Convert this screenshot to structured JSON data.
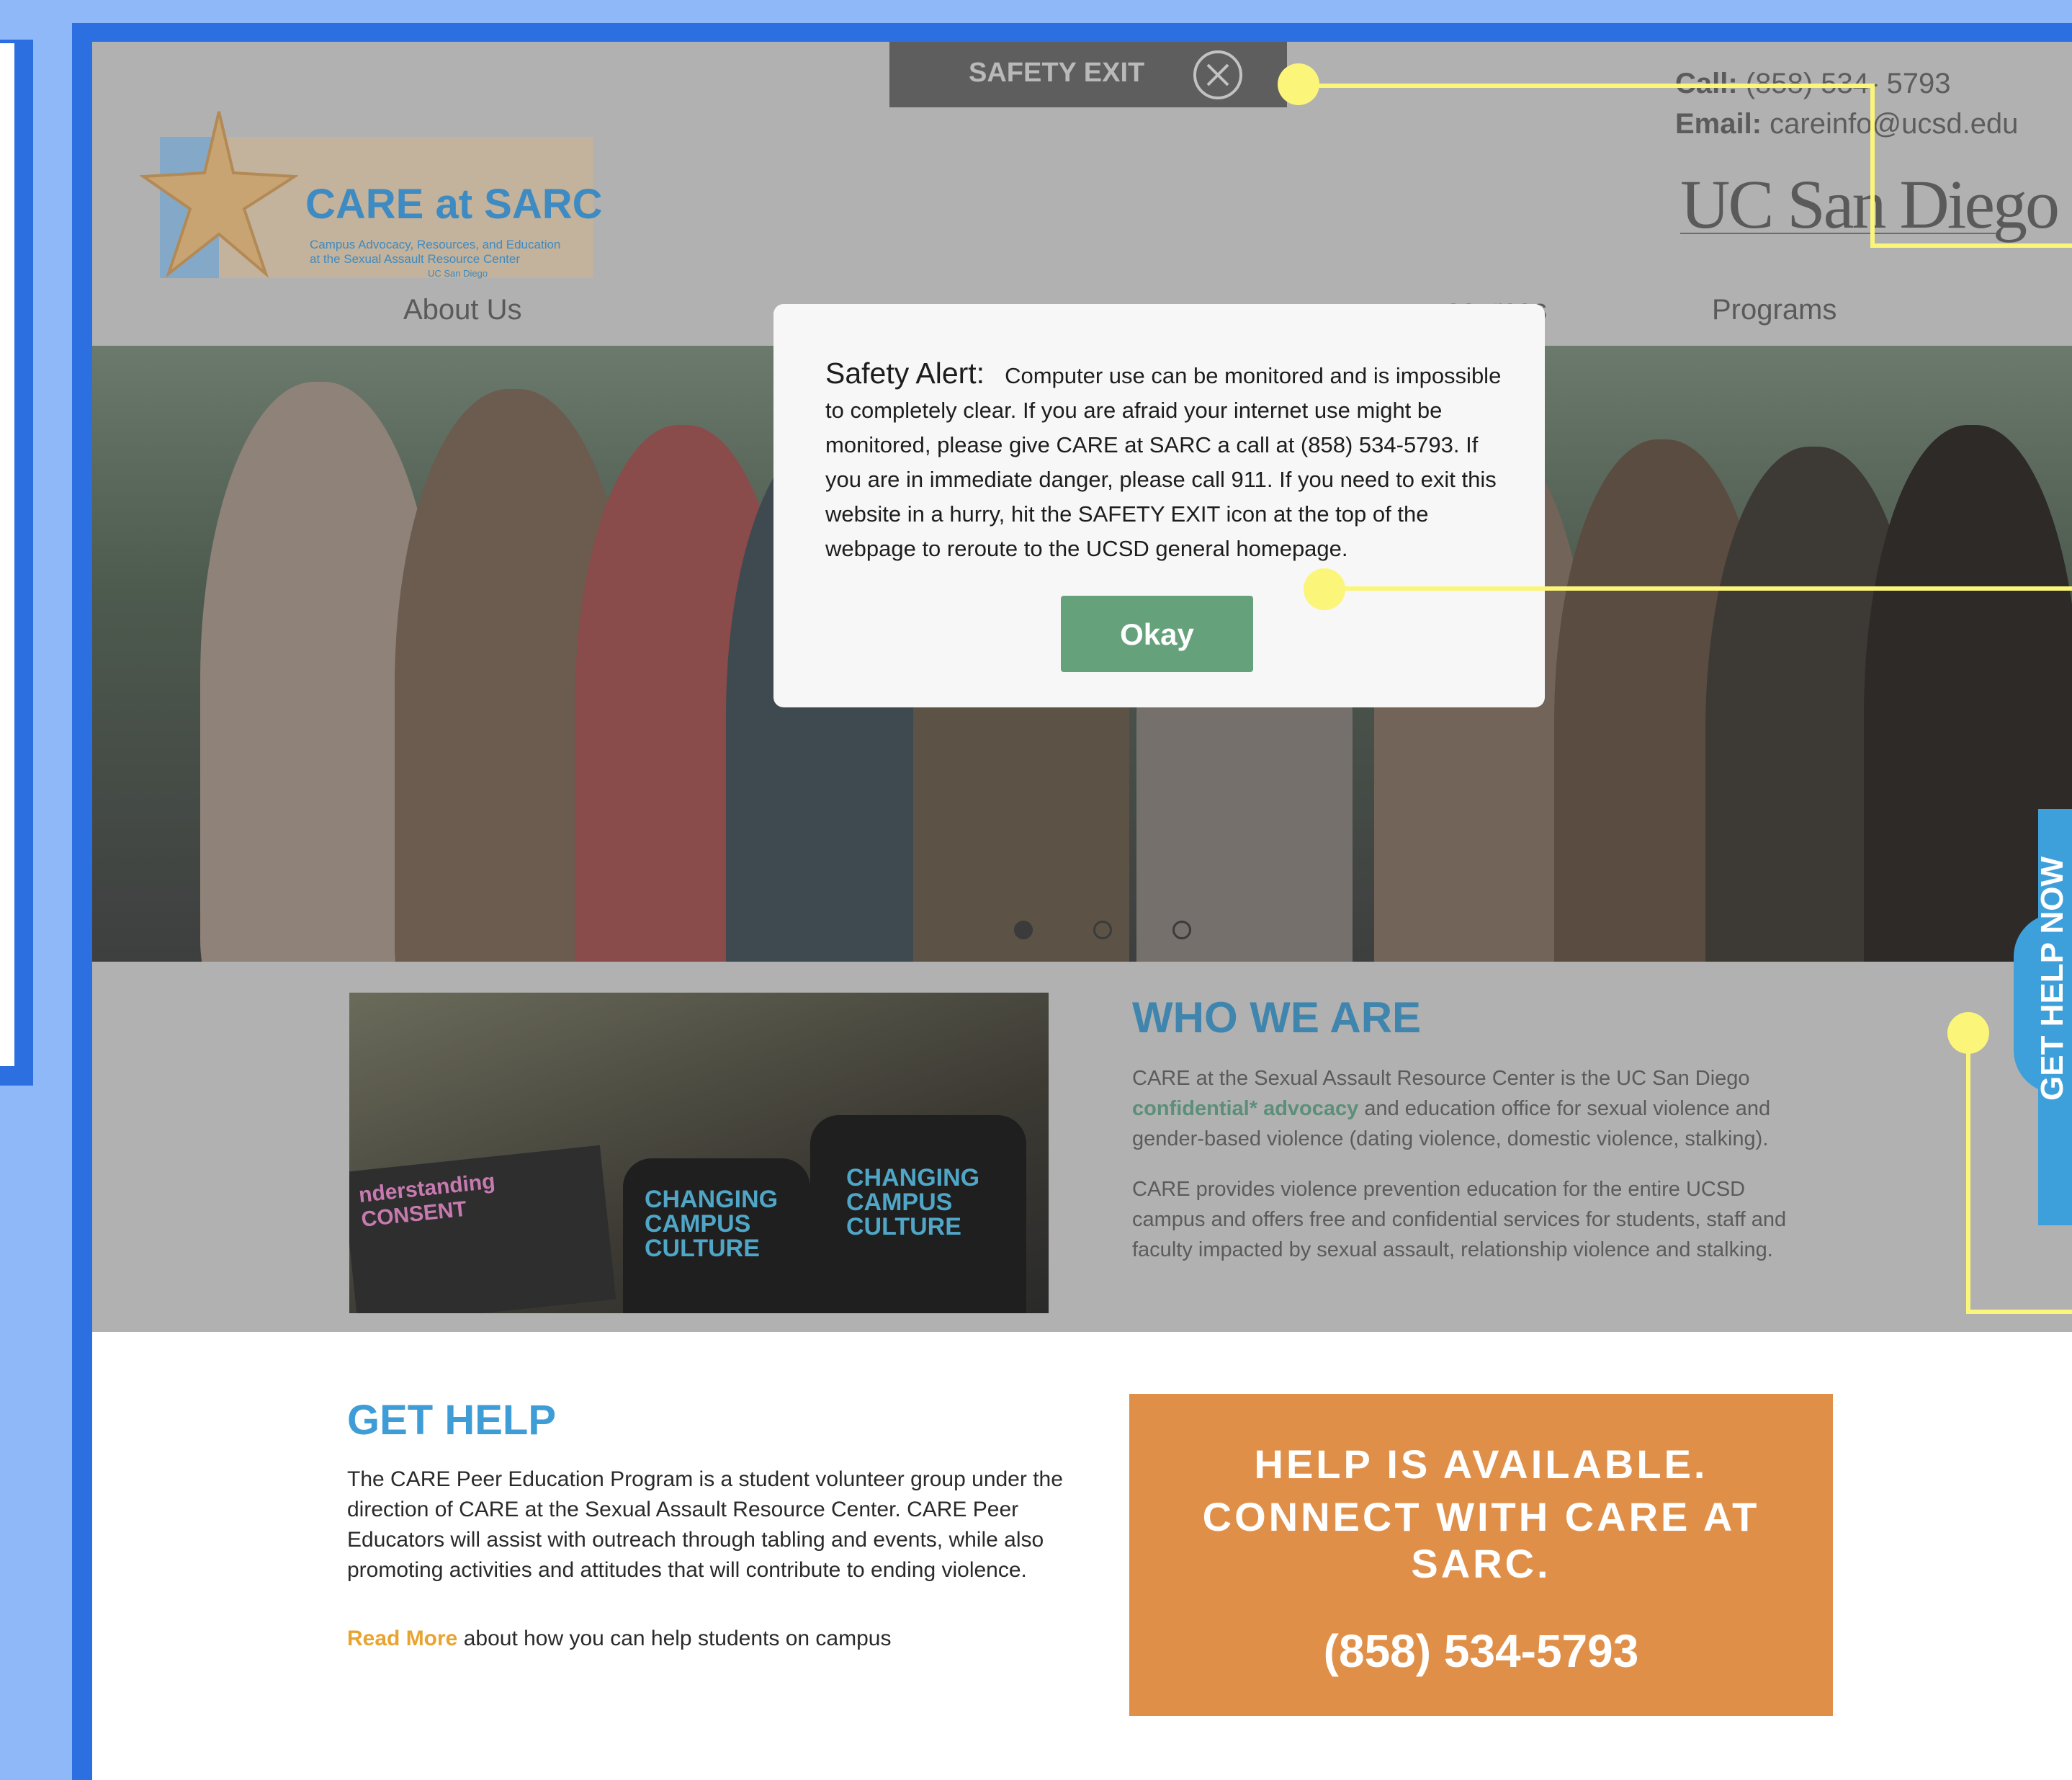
{
  "header": {
    "safety_exit_label": "SAFETY EXIT",
    "call_label": "Call:",
    "call_value": "(858) 534- 5793",
    "email_label": "Email:",
    "email_value": "careinfo@ucsd.edu",
    "university": "UC San Diego"
  },
  "logo": {
    "title": "CARE at SARC",
    "subtitle_line1": "Campus Advocacy, Resources, and Education",
    "subtitle_line2": "at the Sexual Assault Resource Center",
    "subtitle_line3": "UC San Diego"
  },
  "nav": {
    "items": [
      {
        "label": "About Us"
      },
      {
        "label": "sources"
      },
      {
        "label": "Programs"
      }
    ]
  },
  "modal": {
    "heading": "Safety Alert:",
    "body": "Computer use can be monitored and is impossible to completely clear. If you are afraid your internet use might be monitored, please give CARE at SARC a call at (858) 534-5793. If you are in immediate danger, please call 911. If you need to exit this website in a hurry, hit the SAFETY EXIT icon at the top of the webpage to reroute to the UCSD general homepage.",
    "button_label": "Okay"
  },
  "hero": {
    "slides_count": 3,
    "active_slide": 1
  },
  "who": {
    "title": "WHO WE ARE",
    "p1_before": "CARE at the Sexual Assault Resource Center is the UC San Diego ",
    "p1_link": "confidential* advocacy",
    "p1_after": " and education office for sexual violence and gender-based violence (dating violence, domestic violence, stalking).",
    "p2": "CARE provides violence prevention education for the entire UCSD campus and offers free and confidential services for students, staff and faculty impacted by sexual  assault, relationship violence and stalking.",
    "photo_sign": "nderstanding CONSENT",
    "shirt_text_1": "CHANGING CAMPUS CULTURE",
    "shirt_text_2": "CHANGING CAMPUS CULTURE"
  },
  "side_tab": {
    "label": "GET HELP NOW"
  },
  "get_help": {
    "title": "GET HELP",
    "body": "The CARE Peer Education Program is a student volunteer group under the direction of CARE at the Sexual Assault Resource Center. CARE Peer Educators will assist with outreach through tabling and events, while also promoting activities and attitudes that will contribute to ending violence.",
    "read_more": "Read More",
    "read_more_after": " about how you can help students on campus"
  },
  "cta": {
    "line1": "HELP IS AVAILABLE.",
    "line2": "CONNECT WITH CARE AT SARC.",
    "phone": "(858) 534-5793"
  },
  "colors": {
    "frame_blue": "#2b6fe0",
    "callout_yellow": "#fbf57a",
    "accent_blue": "#3e9cd6",
    "okay_green": "#65a27b",
    "cta_orange": "#e08f48"
  }
}
